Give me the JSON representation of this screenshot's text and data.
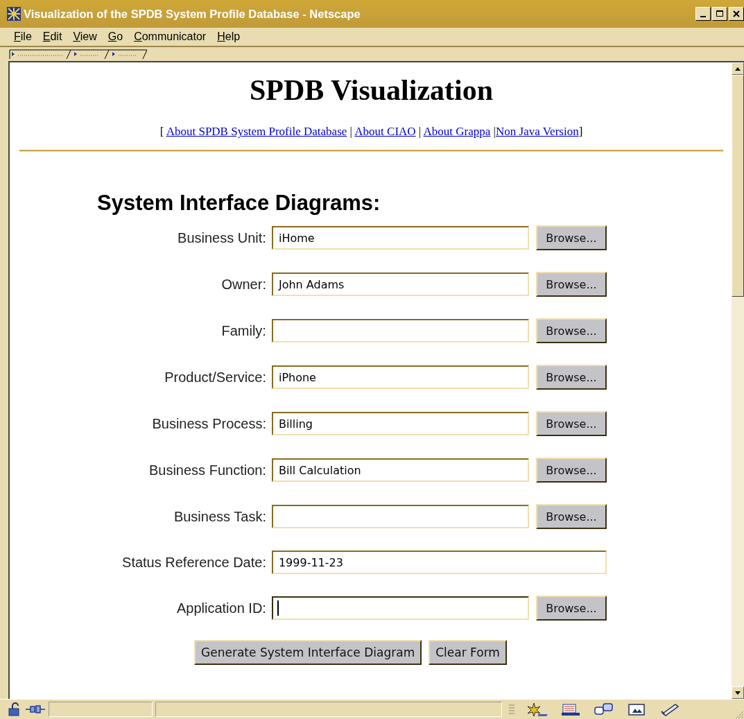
{
  "window": {
    "title": "Visualization of the SPDB System Profile Database - Netscape"
  },
  "menu": [
    "File",
    "Edit",
    "View",
    "Go",
    "Communicator",
    "Help"
  ],
  "page": {
    "heading": "SPDB Visualization",
    "links": {
      "open": "[",
      "separator": "|",
      "close": "]",
      "items": [
        "About SPDB System Profile Database",
        "About CIAO",
        "About Grappa",
        "Non Java Version"
      ]
    },
    "form_title": "System Interface Diagrams:",
    "fields": [
      {
        "kind": "browse",
        "label": "Business Unit:",
        "value": "iHome",
        "button": "Browse...",
        "focused": false
      },
      {
        "kind": "browse",
        "label": "Owner:",
        "value": "John Adams",
        "button": "Browse...",
        "focused": false
      },
      {
        "kind": "browse",
        "label": "Family:",
        "button": "Browse...",
        "focused": false
      },
      {
        "kind": "browse",
        "label": "Product/Service:",
        "value": "iPhone",
        "button": "Browse...",
        "focused": false
      },
      {
        "kind": "browse",
        "label": "Business Process:",
        "value": "Billing",
        "button": "Browse...",
        "focused": false
      },
      {
        "kind": "browse",
        "label": "Business Function:",
        "value": "Bill Calculation",
        "button": "Browse...",
        "focused": false
      },
      {
        "kind": "browse",
        "label": "Business Task:",
        "button": "Browse...",
        "focused": false
      },
      {
        "kind": "plain",
        "label": "Status Reference Date:",
        "value": "1999-11-23",
        "focused": false
      },
      {
        "kind": "browse",
        "label": "Application ID:",
        "button": "Browse...",
        "focused": true
      }
    ],
    "actions": [
      "Generate System Interface Diagram",
      "Clear Form"
    ]
  }
}
